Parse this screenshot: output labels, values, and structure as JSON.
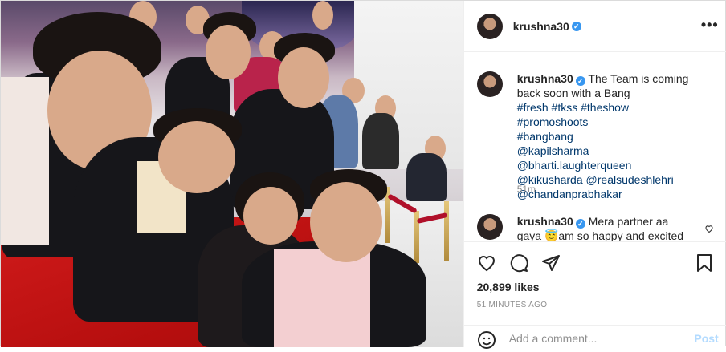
{
  "post": {
    "author": "krushna30",
    "more_icon": "ellipsis-icon",
    "verified_icon": "verified-check-icon"
  },
  "caption": {
    "username": "krushna30",
    "text": "The Team is coming back soon with a Bang",
    "hashtags": [
      "#fresh",
      "#tkss",
      "#theshow",
      "#promoshoots",
      "#bangbang"
    ],
    "mentions": [
      "@kapilsharma",
      "@bharti.laughterqueen",
      "@kikusharda",
      "@realsudeshlehri",
      "@chandanprabhakar"
    ],
    "age": "51m"
  },
  "reply": {
    "username": "krushna30",
    "text": "Mera partner aa gaya 😇am so happy and excited"
  },
  "actions": {
    "icons": [
      "heart-icon",
      "comment-icon",
      "share-icon",
      "bookmark-icon"
    ],
    "likes": "20,899 likes",
    "posted": "51 MINUTES AGO"
  },
  "composer": {
    "placeholder": "Add a comment...",
    "post_label": "Post",
    "emoji_icon": "emoji-icon"
  }
}
